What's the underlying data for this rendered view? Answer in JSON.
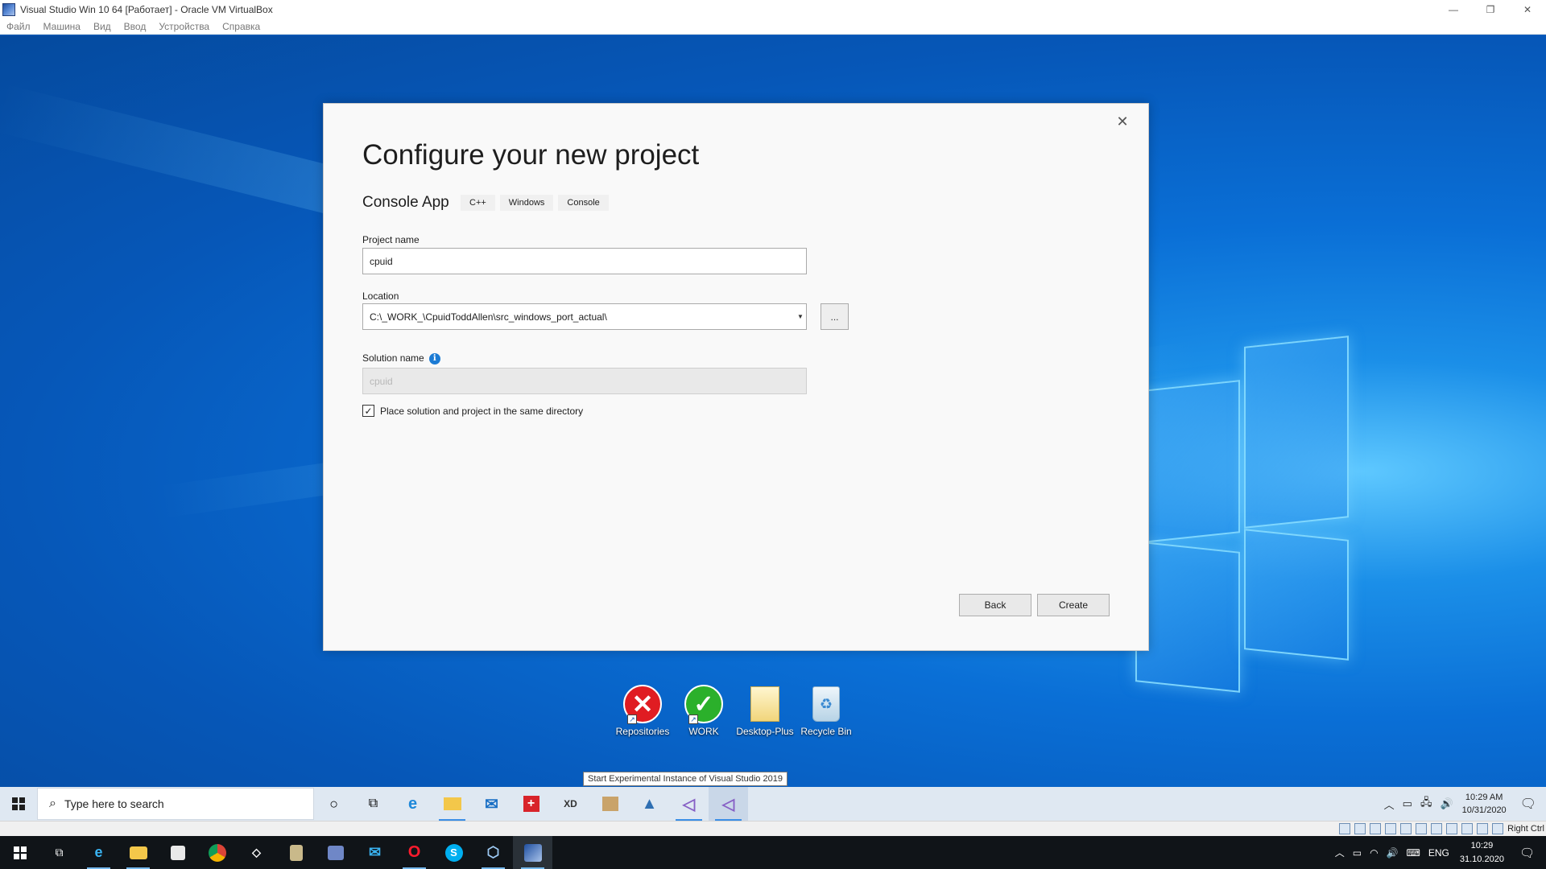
{
  "host_window": {
    "title": "Visual Studio Win 10 64 [Работает] - Oracle VM VirtualBox",
    "menu": [
      "Файл",
      "Машина",
      "Вид",
      "Ввод",
      "Устройства",
      "Справка"
    ],
    "controls": {
      "minimize": "—",
      "restore": "❐",
      "close": "✕"
    }
  },
  "dialog": {
    "close_glyph": "✕",
    "heading": "Configure your new project",
    "template_name": "Console App",
    "tags": [
      "C++",
      "Windows",
      "Console"
    ],
    "project_name_label": "Project name",
    "project_name_value": "cpuid",
    "location_label": "Location",
    "location_value": "C:\\_WORK_\\CpuidToddAllen\\src_windows_port_actual\\",
    "browse_label": "...",
    "solution_name_label": "Solution name",
    "solution_name_value": "cpuid",
    "info_glyph": "i",
    "same_dir_checked": true,
    "same_dir_checkmark": "✓",
    "same_dir_label": "Place solution and project in the same directory",
    "back_label": "Back",
    "create_label": "Create"
  },
  "desktop_icons": [
    {
      "label": "Repositories",
      "icon": "error-x-icon"
    },
    {
      "label": "WORK",
      "icon": "checkmark-icon"
    },
    {
      "label": "Desktop-Plus",
      "icon": "folder-icon"
    },
    {
      "label": "Recycle Bin",
      "icon": "recycle-bin-icon"
    }
  ],
  "tooltip": "Start Experimental Instance of Visual Studio 2019",
  "guest_taskbar": {
    "search_placeholder": "Type here to search",
    "apps": [
      "cortana-icon",
      "task-view-icon",
      "edge-icon",
      "file-explorer-icon",
      "mail-icon",
      "swiss-app-icon",
      "xd-app-icon",
      "package-icon",
      "triangle-app-icon",
      "visual-studio-icon",
      "visual-studio-active-icon"
    ],
    "clock_time": "10:29 AM",
    "clock_date": "10/31/2020"
  },
  "vbox_status": {
    "host_key": "Right Ctrl"
  },
  "host_taskbar": {
    "language": "ENG",
    "clock_time": "10:29",
    "clock_date": "31.10.2020"
  },
  "colors": {
    "accent": "#1c7bd4",
    "error_red": "#e01c22",
    "success_green": "#2bb02b",
    "vs_purple": "#865fc5"
  }
}
